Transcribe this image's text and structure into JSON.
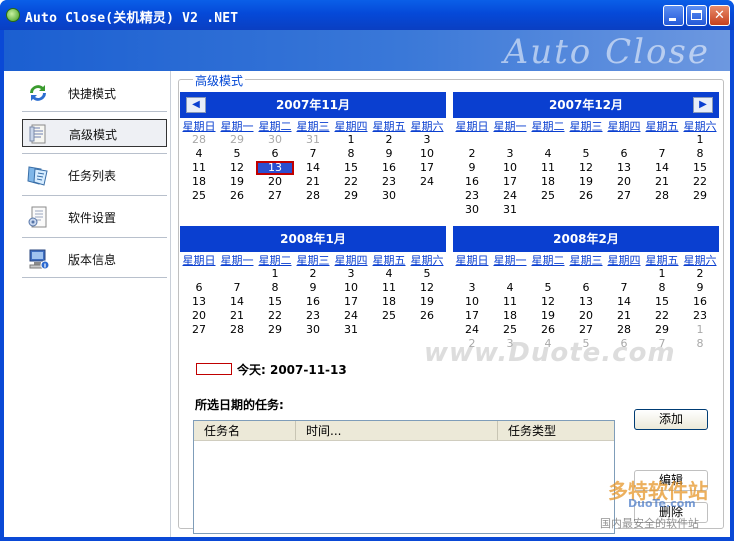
{
  "window": {
    "title": "Auto Close(关机精灵) V2 .NET",
    "banner_logo": "Auto Close"
  },
  "sidebar": {
    "items": [
      {
        "label": "快捷模式",
        "icon": "refresh-arrows-icon",
        "active": false
      },
      {
        "label": "高级模式",
        "icon": "document-icon",
        "active": true
      },
      {
        "label": "任务列表",
        "icon": "task-list-icon",
        "active": false
      },
      {
        "label": "软件设置",
        "icon": "settings-document-icon",
        "active": false
      },
      {
        "label": "版本信息",
        "icon": "computer-info-icon",
        "active": false
      }
    ]
  },
  "main": {
    "group_title": "高级模式",
    "weekdays": [
      "星期日",
      "星期一",
      "星期二",
      "星期三",
      "星期四",
      "星期五",
      "星期六"
    ],
    "calendars": [
      {
        "title": "2007年11月",
        "nav": "prev",
        "days": [
          {
            "d": "28",
            "o": true
          },
          {
            "d": "29",
            "o": true
          },
          {
            "d": "30",
            "o": true
          },
          {
            "d": "31",
            "o": true
          },
          {
            "d": "1"
          },
          {
            "d": "2"
          },
          {
            "d": "3"
          },
          {
            "d": "4"
          },
          {
            "d": "5"
          },
          {
            "d": "6"
          },
          {
            "d": "7"
          },
          {
            "d": "8"
          },
          {
            "d": "9"
          },
          {
            "d": "10"
          },
          {
            "d": "11"
          },
          {
            "d": "12"
          },
          {
            "d": "13",
            "today": true
          },
          {
            "d": "14"
          },
          {
            "d": "15"
          },
          {
            "d": "16"
          },
          {
            "d": "17"
          },
          {
            "d": "18"
          },
          {
            "d": "19"
          },
          {
            "d": "20"
          },
          {
            "d": "21"
          },
          {
            "d": "22"
          },
          {
            "d": "23"
          },
          {
            "d": "24"
          },
          {
            "d": "25"
          },
          {
            "d": "26"
          },
          {
            "d": "27"
          },
          {
            "d": "28"
          },
          {
            "d": "29"
          },
          {
            "d": "30"
          }
        ]
      },
      {
        "title": "2007年12月",
        "nav": "next",
        "days": [
          {
            "d": "",
            "o": true
          },
          {
            "d": "",
            "o": true
          },
          {
            "d": "",
            "o": true
          },
          {
            "d": "",
            "o": true
          },
          {
            "d": "",
            "o": true
          },
          {
            "d": "",
            "o": true
          },
          {
            "d": "1"
          },
          {
            "d": "2"
          },
          {
            "d": "3"
          },
          {
            "d": "4"
          },
          {
            "d": "5"
          },
          {
            "d": "6"
          },
          {
            "d": "7"
          },
          {
            "d": "8"
          },
          {
            "d": "9"
          },
          {
            "d": "10"
          },
          {
            "d": "11"
          },
          {
            "d": "12"
          },
          {
            "d": "13"
          },
          {
            "d": "14"
          },
          {
            "d": "15"
          },
          {
            "d": "16"
          },
          {
            "d": "17"
          },
          {
            "d": "18"
          },
          {
            "d": "19"
          },
          {
            "d": "20"
          },
          {
            "d": "21"
          },
          {
            "d": "22"
          },
          {
            "d": "23"
          },
          {
            "d": "24"
          },
          {
            "d": "25"
          },
          {
            "d": "26"
          },
          {
            "d": "27"
          },
          {
            "d": "28"
          },
          {
            "d": "29"
          },
          {
            "d": "30"
          },
          {
            "d": "31"
          }
        ]
      },
      {
        "title": "2008年1月",
        "nav": "",
        "days": [
          {
            "d": "",
            "o": true
          },
          {
            "d": "",
            "o": true
          },
          {
            "d": "1"
          },
          {
            "d": "2"
          },
          {
            "d": "3"
          },
          {
            "d": "4"
          },
          {
            "d": "5"
          },
          {
            "d": "6"
          },
          {
            "d": "7"
          },
          {
            "d": "8"
          },
          {
            "d": "9"
          },
          {
            "d": "10"
          },
          {
            "d": "11"
          },
          {
            "d": "12"
          },
          {
            "d": "13"
          },
          {
            "d": "14"
          },
          {
            "d": "15"
          },
          {
            "d": "16"
          },
          {
            "d": "17"
          },
          {
            "d": "18"
          },
          {
            "d": "19"
          },
          {
            "d": "20"
          },
          {
            "d": "21"
          },
          {
            "d": "22"
          },
          {
            "d": "23"
          },
          {
            "d": "24"
          },
          {
            "d": "25"
          },
          {
            "d": "26"
          },
          {
            "d": "27"
          },
          {
            "d": "28"
          },
          {
            "d": "29"
          },
          {
            "d": "30"
          },
          {
            "d": "31"
          }
        ]
      },
      {
        "title": "2008年2月",
        "nav": "",
        "days": [
          {
            "d": "",
            "o": true
          },
          {
            "d": "",
            "o": true
          },
          {
            "d": "",
            "o": true
          },
          {
            "d": "",
            "o": true
          },
          {
            "d": "",
            "o": true
          },
          {
            "d": "1"
          },
          {
            "d": "2"
          },
          {
            "d": "3"
          },
          {
            "d": "4"
          },
          {
            "d": "5"
          },
          {
            "d": "6"
          },
          {
            "d": "7"
          },
          {
            "d": "8"
          },
          {
            "d": "9"
          },
          {
            "d": "10"
          },
          {
            "d": "11"
          },
          {
            "d": "12"
          },
          {
            "d": "13"
          },
          {
            "d": "14"
          },
          {
            "d": "15"
          },
          {
            "d": "16"
          },
          {
            "d": "17"
          },
          {
            "d": "18"
          },
          {
            "d": "19"
          },
          {
            "d": "20"
          },
          {
            "d": "21"
          },
          {
            "d": "22"
          },
          {
            "d": "23"
          },
          {
            "d": "24"
          },
          {
            "d": "25"
          },
          {
            "d": "26"
          },
          {
            "d": "27"
          },
          {
            "d": "28"
          },
          {
            "d": "29"
          },
          {
            "d": "1",
            "o": true
          },
          {
            "d": "2",
            "o": true
          },
          {
            "d": "3",
            "o": true
          },
          {
            "d": "4",
            "o": true
          },
          {
            "d": "5",
            "o": true
          },
          {
            "d": "6",
            "o": true
          },
          {
            "d": "7",
            "o": true
          },
          {
            "d": "8",
            "o": true
          }
        ]
      }
    ],
    "today_label": "今天: 2007-11-13",
    "tasks_label": "所选日期的任务:",
    "columns": [
      "任务名",
      "时间...",
      "任务类型"
    ],
    "buttons": {
      "add": "添加",
      "edit": "编辑",
      "delete": "删除"
    }
  },
  "watermarks": {
    "center": "www.Duote.com",
    "corner_logo": "多特软件站",
    "corner_site": "DuoTe.com",
    "corner_sub": "国内最安全的软件站"
  },
  "colors": {
    "titlebar": "#0549d8",
    "calendar_header": "#0a3fd0",
    "today_border": "#c00000"
  }
}
